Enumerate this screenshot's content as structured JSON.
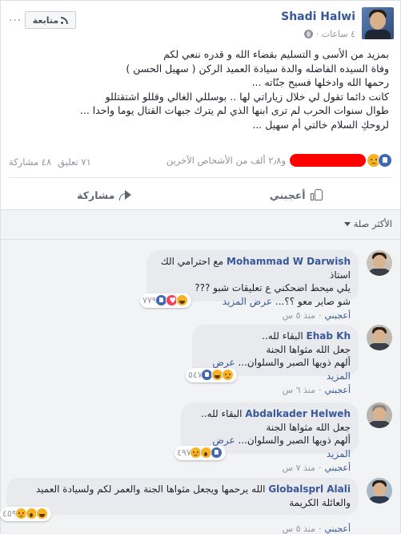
{
  "post": {
    "author": "Shadi Halwi",
    "time": "٤ ساعات ·",
    "follow_label": "متابعة",
    "more_icon": "ellipsis-icon",
    "lines": [
      "بمزيد من الأسى و التسليم بقضاء الله و قدره ننعي لكم",
      "وفاة السيده الفاضله والدة سيادة العميد الركن ( سهيل الحسن )",
      "رحمها الله وادخلها فسيح جنّاته ...",
      "كانت دائما تقول لي خلال زياراتي لها .. بوسللي الغالي وقللو اشتقتللو",
      "طوال سنوات الحرب لم ترى ابنها الذي لم يترك جبهات القتال يوما واحدا ...",
      "لروحكِ السلام خالتي أم سهيل ..."
    ],
    "reactions_text": "و٢٫٨ ألف من الأشخاص الآخرين",
    "comments_count": "٧١ تعليق",
    "shares_count": "٤٨ مشاركة",
    "like_label": "أعجبني",
    "share_label": "مشاركة"
  },
  "comments_section": {
    "sort_label": "الأكثر صلة",
    "comments": [
      {
        "name": "Mohammad W Darwish",
        "lines": [
          "مع احترامي الك استاذ",
          "يلي ميحط اضحكني ع تعليقات شبو ???",
          "شو صاير معو ؟؟..."
        ],
        "more": "عرض المزيد",
        "reaction_count": "٧٧٩",
        "like": "أعجبني",
        "time": "منذ ٥ س"
      },
      {
        "name": "Ehab Kh",
        "lines": [
          "البقاء لله..",
          "جعل الله مثواها الجنة",
          "ألهم ذويها الصبر والسلوان..."
        ],
        "more": "عرض المزيد",
        "reaction_count": "٥٤٧",
        "like": "أعجبني",
        "time": "منذ ٦ س"
      },
      {
        "name": "Abdalkader Helweh",
        "lines": [
          "البقاء لله..",
          "جعل الله مثواها الجنة",
          "ألهم ذويها الصبر والسلوان..."
        ],
        "more": "عرض المزيد",
        "reaction_count": "٤٩٧",
        "like": "أعجبني",
        "time": "منذ ٧ س"
      },
      {
        "name": "Globalsprl Alali",
        "lines": [
          "الله يرحمها ويجعل مثواها الجنة والعمر لكم ولسيادة العميد",
          "والعائلة الكريمة"
        ],
        "more": "",
        "reaction_count": "٤٥٩",
        "like": "أعجبني",
        "time": "منذ ٥ س"
      }
    ]
  },
  "colors": {
    "link": "#385898",
    "like_blue": "#4267b2",
    "redaction": "#ff0000"
  }
}
